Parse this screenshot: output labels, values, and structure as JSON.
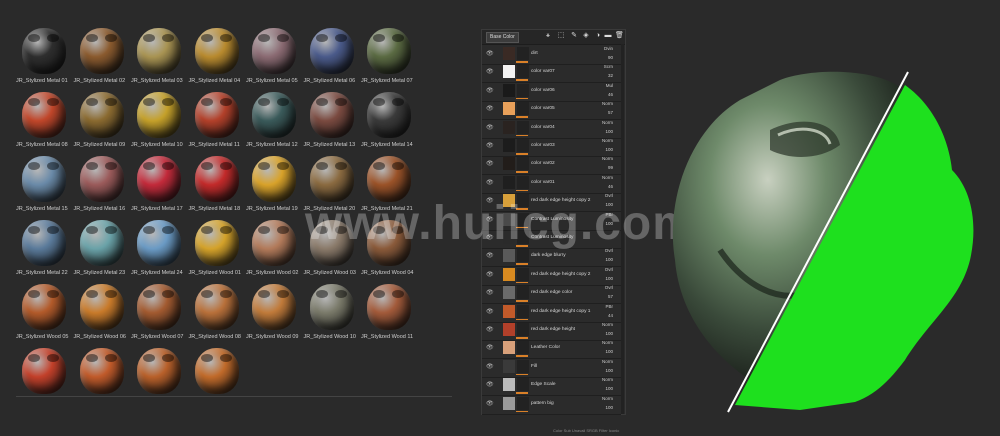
{
  "gallery": {
    "materials": [
      {
        "label": "JR_Stylized Metal 01",
        "color": "#2e2e2e"
      },
      {
        "label": "JR_Stylized Metal 02",
        "color": "#8a5a2e"
      },
      {
        "label": "JR_Stylized Metal 03",
        "color": "#a89352"
      },
      {
        "label": "JR_Stylized Metal 04",
        "color": "#b88a2e"
      },
      {
        "label": "JR_Stylized Metal 05",
        "color": "#8a6a72"
      },
      {
        "label": "JR_Stylized Metal 06",
        "color": "#4a5a8a"
      },
      {
        "label": "JR_Stylized Metal 07",
        "color": "#5a6a42"
      },
      {
        "label": "JR_Stylized Metal 08",
        "color": "#c0462a"
      },
      {
        "label": "JR_Stylized Metal 09",
        "color": "#8a6a30"
      },
      {
        "label": "JR_Stylized Metal 10",
        "color": "#c4a02a"
      },
      {
        "label": "JR_Stylized Metal 11",
        "color": "#b2402a"
      },
      {
        "label": "JR_Stylized Metal 12",
        "color": "#3a5a5a"
      },
      {
        "label": "JR_Stylized Metal 13",
        "color": "#7a4a40"
      },
      {
        "label": "JR_Stylized Metal 14",
        "color": "#3a3a3a"
      },
      {
        "label": "JR_Stylized Metal 15",
        "color": "#6a8aa8"
      },
      {
        "label": "JR_Stylized Metal 16",
        "color": "#9a5a5a"
      },
      {
        "label": "JR_Stylized Metal 17",
        "color": "#c22a3a"
      },
      {
        "label": "JR_Stylized Metal 18",
        "color": "#c22a2a"
      },
      {
        "label": "JR_Stylized Metal 19",
        "color": "#d8a22a"
      },
      {
        "label": "JR_Stylized Metal 20",
        "color": "#8a6a40"
      },
      {
        "label": "JR_Stylized Metal 21",
        "color": "#9a5228"
      },
      {
        "label": "JR_Stylized Metal 22",
        "color": "#5a7a9a"
      },
      {
        "label": "JR_Stylized Metal 23",
        "color": "#6aa2a8"
      },
      {
        "label": "JR_Stylized Metal 24",
        "color": "#6a9ac4"
      },
      {
        "label": "JR_Stylized Wood 01",
        "color": "#d4a22a"
      },
      {
        "label": "JR_Stylized Wood 02",
        "color": "#b27a5a"
      },
      {
        "label": "JR_Stylized Wood 03",
        "color": "#8a7a6a"
      },
      {
        "label": "JR_Stylized Wood 04",
        "color": "#8a5a3a"
      },
      {
        "label": "JR_Stylized Wood 05",
        "color": "#b25a2a"
      },
      {
        "label": "JR_Stylized Wood 06",
        "color": "#c87a2a"
      },
      {
        "label": "JR_Stylized Wood 07",
        "color": "#a25a30"
      },
      {
        "label": "JR_Stylized Wood 08",
        "color": "#b8703a"
      },
      {
        "label": "JR_Stylized Wood 09",
        "color": "#c07a3a"
      },
      {
        "label": "JR_Stylized Wood 10",
        "color": "#7a7a6a"
      },
      {
        "label": "JR_Stylized Wood 11",
        "color": "#a25a3a"
      },
      {
        "label": "",
        "color": "#c2402a"
      },
      {
        "label": "",
        "color": "#c05a2a"
      },
      {
        "label": "",
        "color": "#b8602a"
      },
      {
        "label": "",
        "color": "#c06a2a"
      }
    ]
  },
  "layers_panel": {
    "blend_mode": "Base Color",
    "layers": [
      {
        "name": "dirt",
        "blend": "Dvin",
        "opacity": "90",
        "thumb": "#3a2a24"
      },
      {
        "name": "color var07",
        "blend": "Scrn",
        "opacity": "32",
        "thumb": "#f2f2f2"
      },
      {
        "name": "color var06",
        "blend": "Mul",
        "opacity": "46",
        "thumb": "#1a1a1a"
      },
      {
        "name": "color var05",
        "blend": "Norm",
        "opacity": "57",
        "thumb": "#e8a05a"
      },
      {
        "name": "color var04",
        "blend": "Norm",
        "opacity": "100",
        "thumb": "#2a2320"
      },
      {
        "name": "color var03",
        "blend": "Norm",
        "opacity": "100",
        "thumb": "#1c1c1c"
      },
      {
        "name": "color var02",
        "blend": "Norm",
        "opacity": "99",
        "thumb": "#221d1a"
      },
      {
        "name": "color var01",
        "blend": "Norm",
        "opacity": "46",
        "thumb": "#1f1f1f"
      },
      {
        "name": "red dark edge height copy 2",
        "blend": "Ovrl",
        "opacity": "100",
        "thumb": "#d8a03a"
      },
      {
        "name": "Contrast Luminosity",
        "blend": "PBr",
        "opacity": "100",
        "thumb": "#4a4a4a"
      },
      {
        "name": "Contrast Luminosity",
        "blend": "",
        "opacity": "",
        "thumb": "#2a2a2a"
      },
      {
        "name": "dark edge blurry",
        "blend": "Ovrl",
        "opacity": "100",
        "thumb": "#5a5a5a"
      },
      {
        "name": "red dark edge height copy 2",
        "blend": "Ovrl",
        "opacity": "100",
        "thumb": "#d88a20"
      },
      {
        "name": "red dark edge color",
        "blend": "Ovrl",
        "opacity": "57",
        "thumb": "#6a6a6a"
      },
      {
        "name": "red dark edge height copy 1",
        "blend": "PBr",
        "opacity": "44",
        "thumb": "#c25a2a"
      },
      {
        "name": "red dark edge height",
        "blend": "Norm",
        "opacity": "100",
        "thumb": "#b2402a"
      },
      {
        "name": "Leather Color",
        "blend": "Norm",
        "opacity": "100",
        "thumb": "#d8a07a"
      },
      {
        "name": "Fill",
        "blend": "Norm",
        "opacity": "100",
        "thumb": "#3a3a3a"
      },
      {
        "name": "Edge Scale",
        "blend": "Norm",
        "opacity": "100",
        "thumb": "#bbbbbb"
      },
      {
        "name": "pattern big",
        "blend": "Norm",
        "opacity": "100",
        "thumb": "#9a9a9a"
      }
    ],
    "status": "Color Sub Unavail  SRGB  Filter Iconic"
  },
  "watermark": "www.huiicg.com",
  "preview": {
    "mask_color": "#1ee01e"
  }
}
